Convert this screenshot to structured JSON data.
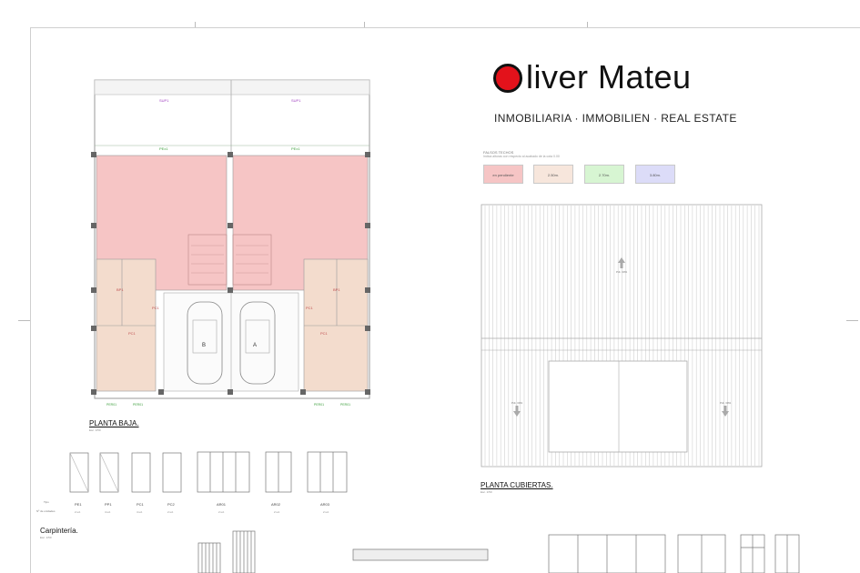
{
  "brand": {
    "name": "liver Mateu",
    "tagline": "INMOBILIARIA · IMMOBILIEN · REAL ESTATE",
    "accent": "#e3121b"
  },
  "legend": {
    "title": "FALSOS TECHOS",
    "subtitle": "Indica alturas con respecto al acabado de la cota 0.00",
    "items": [
      {
        "label": "en pendiente",
        "color": "#f6c5c5"
      },
      {
        "label": "2.50m.",
        "color": "#f7e6dc"
      },
      {
        "label": "2.70m.",
        "color": "#d7f5d2"
      },
      {
        "label": "3.80m.",
        "color": "#dcdcf8"
      }
    ]
  },
  "ground_floor": {
    "title": "PLANTA BAJA.",
    "scale": "Esc. 1/50",
    "garden_labels": [
      "SUP1",
      "SUP1"
    ],
    "terrace_labels": [
      "PEx1",
      "PEx1"
    ],
    "bath_labels": [
      "BP1",
      "BP1"
    ],
    "hall_labels": [
      "PC1",
      "PC1"
    ],
    "kitchen_labels": [
      "PC1",
      "PC1"
    ],
    "door_labels": [
      "PER01",
      "PER01",
      "PER01",
      "PER01"
    ],
    "garage_labels": [
      "B",
      "A"
    ]
  },
  "roof": {
    "title": "PLANTA CUBIERTAS.",
    "scale": "Esc. 1/50",
    "slope_labels": [
      "Pdt. 30%",
      "Pdt. 30%",
      "Pdt. 30%"
    ]
  },
  "carpentry": {
    "title": "Carpintería.",
    "scale": "Esc. 1/50",
    "items": [
      {
        "code": "PE1",
        "qty": "2 ud."
      },
      {
        "code": "PP1",
        "qty": "4 ud."
      },
      {
        "code": "PC1",
        "qty": "4 ud."
      },
      {
        "code": "PC2",
        "qty": "2 ud."
      },
      {
        "code": "AR01",
        "qty": "2 ud."
      },
      {
        "code": "AR02",
        "qty": "2 ud."
      },
      {
        "code": "AR03",
        "qty": "2 ud."
      }
    ],
    "row_headers": [
      "Tipo",
      "Nº de unidades"
    ]
  }
}
